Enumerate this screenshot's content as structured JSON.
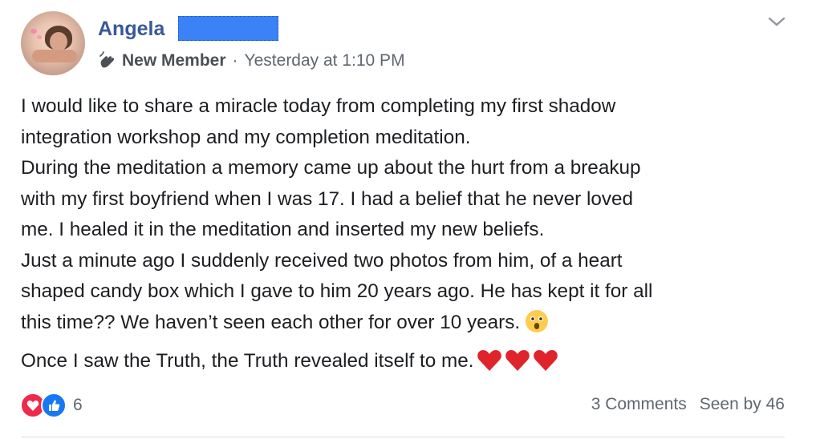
{
  "author": {
    "name": "Angela"
  },
  "meta": {
    "badge": "New Member",
    "separator": "·",
    "timestamp": "Yesterday at 1:10 PM"
  },
  "post": {
    "paragraphs": [
      "I would like to share a miracle today from completing my first shadow\nintegration workshop and my completion meditation.\nDuring the meditation a memory came up about the hurt from a breakup\nwith my first boyfriend when I was 17. I had a belief that he never loved\nme. I healed it in the meditation and inserted my new beliefs.\nJust a minute ago I suddenly received two photos from him, of a heart\nshaped candy box which I gave to him 20 years ago. He has kept it for all\nthis time?? We haven’t seen each other for over 10 years.",
      "Once I saw the Truth, the Truth revealed itself to me."
    ]
  },
  "footer": {
    "reaction_count": "6",
    "comments": "3 Comments",
    "seen_by": "Seen by 46"
  },
  "icons": {
    "avatar": "profile-photo",
    "badge": "wave-hand-icon",
    "chevron": "chevron-down-icon",
    "emoji_1": "astonished-face-emoji",
    "emoji_2": "red-heart-emoji",
    "reaction_1": "love-reaction-icon",
    "reaction_2": "like-reaction-icon"
  },
  "colors": {
    "name": "#385898",
    "love": "#f02849",
    "like": "#1877f2",
    "meta": "#606770",
    "redaction": "#3b82f6"
  }
}
